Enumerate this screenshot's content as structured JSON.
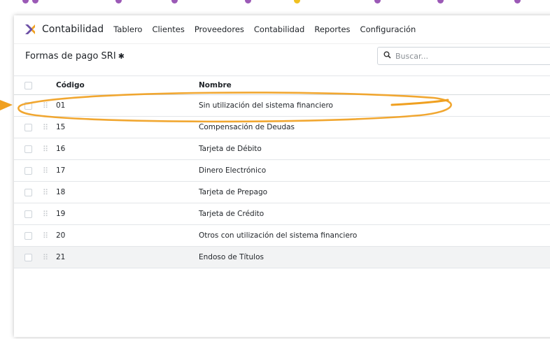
{
  "app": {
    "name": "Contabilidad",
    "menu": [
      "Tablero",
      "Clientes",
      "Proveedores",
      "Contabilidad",
      "Reportes",
      "Configuración"
    ]
  },
  "control_panel": {
    "breadcrumb": "Formas de pago SRI",
    "search_placeholder": "Buscar..."
  },
  "table": {
    "columns": {
      "code": "Código",
      "name": "Nombre"
    },
    "rows": [
      {
        "code": "01",
        "name": "Sin utilización del sistema financiero"
      },
      {
        "code": "15",
        "name": "Compensación de Deudas"
      },
      {
        "code": "16",
        "name": "Tarjeta de Débito"
      },
      {
        "code": "17",
        "name": "Dinero Electrónico"
      },
      {
        "code": "18",
        "name": "Tarjeta de Prepago"
      },
      {
        "code": "19",
        "name": "Tarjeta de Crédito"
      },
      {
        "code": "20",
        "name": "Otros con utilización del sistema financiero"
      },
      {
        "code": "21",
        "name": "Endoso de Títulos"
      }
    ]
  },
  "colors": {
    "annotation": "#f0a020",
    "logo_purple": "#6c4fa5",
    "logo_orange": "#f0a020"
  }
}
